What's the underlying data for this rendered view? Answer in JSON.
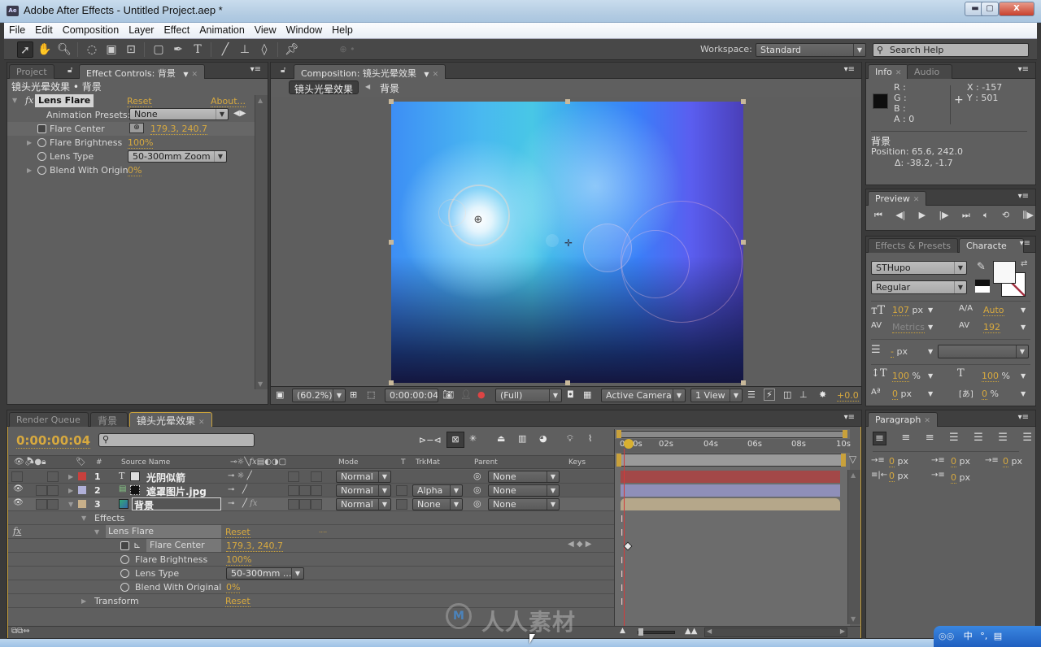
{
  "window": {
    "app_icon": "Ae",
    "title": "Adobe After Effects - Untitled Project.aep *",
    "minimize_icon": "minimize-icon",
    "maximize_icon": "maximize-icon",
    "close_icon": "close-icon"
  },
  "menu": [
    "File",
    "Edit",
    "Composition",
    "Layer",
    "Effect",
    "Animation",
    "View",
    "Window",
    "Help"
  ],
  "toolbar": {
    "tools": [
      "selection-tool",
      "hand-tool",
      "zoom-tool",
      "rotation-tool",
      "camera-tool",
      "pan-behind-tool",
      "rectangle-tool",
      "pen-tool",
      "type-tool",
      "brush-tool",
      "clone-stamp-tool",
      "eraser-tool",
      "puppet-pin-tool"
    ],
    "workspace_label": "Workspace:",
    "workspace_value": "Standard",
    "search_placeholder": "Search Help"
  },
  "effect_controls": {
    "tabs": {
      "project": "Project",
      "effect_controls": "Effect Controls: 背景"
    },
    "breadcrumb": "镜头光晕效果 • 背景",
    "effect_name": "Lens Flare",
    "reset": "Reset",
    "about": "About...",
    "animation_presets_label": "Animation Presets:",
    "animation_presets_value": "None",
    "properties": [
      {
        "name": "Flare Center",
        "value": "179.3, 240.7"
      },
      {
        "name": "Flare Brightness",
        "value": "100%"
      },
      {
        "name": "Lens Type",
        "value": "50-300mm Zoom"
      },
      {
        "name": "Blend With Origin",
        "value": "0%"
      }
    ]
  },
  "composition": {
    "tab": "Composition: 镜头光晕效果",
    "nav": [
      "镜头光晕效果",
      "背景"
    ],
    "footer": {
      "magnification": "(60.2%)",
      "timecode": "0:00:00:04",
      "resolution": "(Full)",
      "camera": "Active Camera",
      "view": "1 View",
      "exposure": "+0.0"
    }
  },
  "info": {
    "tabs": [
      "Info",
      "Audio"
    ],
    "r": "R :",
    "g": "G :",
    "b": "B :",
    "a": "A : 0",
    "x": "X : -157",
    "y": "Y : 501",
    "layer": "背景",
    "position": "Position: 65.6, 242.0",
    "delta": "Δ: -38.2, -1.7"
  },
  "preview": {
    "tab": "Preview"
  },
  "character": {
    "tabs": [
      "Effects & Presets",
      "Characte"
    ],
    "font": "STHupo",
    "style": "Regular",
    "size": "107",
    "size_unit": "px",
    "leading": "Auto",
    "kerning": "Metrics",
    "tracking": "192",
    "stroke": "-",
    "stroke_unit": "px",
    "vscale": "100",
    "vscale_unit": "%",
    "hscale": "100",
    "hscale_unit": "%",
    "baseline": "0",
    "baseline_unit": "px",
    "tsume": "0",
    "tsume_unit": "%"
  },
  "paragraph": {
    "tab": "Paragraph",
    "indents": [
      {
        "value": "0",
        "unit": "px"
      },
      {
        "value": "0",
        "unit": "px"
      },
      {
        "value": "0",
        "unit": "px"
      },
      {
        "value": "0",
        "unit": "px"
      },
      {
        "value": "0",
        "unit": "px"
      }
    ]
  },
  "timeline": {
    "tabs": [
      "Render Queue",
      "背景",
      "镜头光晕效果"
    ],
    "timecode": "0:00:00:04",
    "search_placeholder": "",
    "columns": {
      "num": "#",
      "source": "Source Name",
      "mode": "Mode",
      "t": "T",
      "trkmat": "TrkMat",
      "parent": "Parent",
      "keys": "Keys"
    },
    "ruler": [
      "0:00s",
      "02s",
      "04s",
      "06s",
      "08s",
      "10s"
    ],
    "layers": [
      {
        "num": "1",
        "name": "光阴似箭",
        "color": "#c8403d",
        "mode": "Normal",
        "trkmat": "",
        "parent": "None",
        "bar": "#a34848",
        "type": "text"
      },
      {
        "num": "2",
        "name": "遮罩图片.jpg",
        "color": "#b0b0d8",
        "mode": "Normal",
        "trkmat": "Alpha",
        "parent": "None",
        "bar": "#8f8fb9",
        "type": "image"
      },
      {
        "num": "3",
        "name": "背景",
        "color": "#c8b08a",
        "mode": "Normal",
        "trkmat": "None",
        "parent": "None",
        "bar": "#b5a78a",
        "type": "comp"
      }
    ],
    "effects_label": "Effects",
    "effect_name": "Lens Flare",
    "effect_reset": "Reset",
    "effect_more": "....",
    "properties": [
      {
        "name": "Flare Center",
        "value": "179.3, 240.7"
      },
      {
        "name": "Flare Brightness",
        "value": "100%"
      },
      {
        "name": "Lens Type",
        "value": "50-300mm ..."
      },
      {
        "name": "Blend With Original",
        "value": "0%"
      }
    ],
    "transform_label": "Transform",
    "transform_reset": "Reset"
  },
  "watermark": "人人素材"
}
